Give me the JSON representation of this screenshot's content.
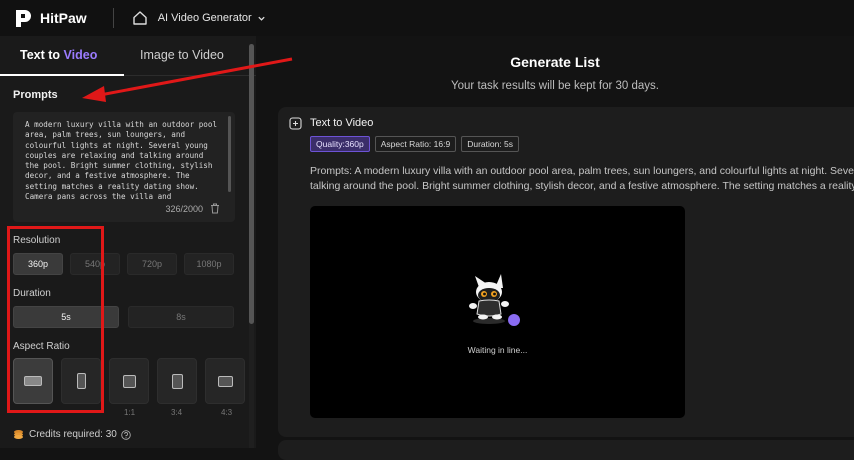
{
  "topbar": {
    "brand": "HitPaw",
    "nav_title": "AI Video Generator",
    "icons": [
      "hitpaw-logo-icon",
      "home-icon",
      "chevron-down-icon"
    ]
  },
  "sidebar": {
    "tabs": [
      {
        "label_prefix": "Text to ",
        "label_accent": "Video",
        "active": true
      },
      {
        "label": "Image to Video",
        "active": false
      }
    ],
    "prompts_label": "Prompts",
    "prompt_text": "A modern luxury villa with an outdoor pool area, palm trees, sun loungers, and colourful lights at night. Several young couples are relaxing and talking around the pool. Bright summer clothing, stylish decor, and a festive atmosphere. The setting matches a reality dating show. Camera pans across the villa and",
    "prompt_counter": "326/2000",
    "resolution_label": "Resolution",
    "resolutions": [
      "360p",
      "540p",
      "720p",
      "1080p"
    ],
    "resolution_selected": "360p",
    "duration_label": "Duration",
    "durations": [
      "5s",
      "8s"
    ],
    "duration_selected": "5s",
    "aspect_label": "Aspect Ratio",
    "aspect_partial_labels": [
      "1:1",
      "3:4",
      "4:3"
    ],
    "credits": "Credits required: 30"
  },
  "main": {
    "title": "Generate List",
    "subtitle": "Your task results will be kept for 30 days.",
    "card": {
      "title": "Text to Video",
      "tags": [
        "Quality:360p",
        "Aspect Ratio: 16:9",
        "Duration: 5s"
      ],
      "prompt_line1": "Prompts:  A modern luxury villa with an outdoor pool area, palm trees, sun loungers, and colourful lights at night. Several young couples are relaxing and",
      "prompt_line2": "talking around the pool. Bright summer clothing, stylish decor, and a festive atmosphere. The setting matches a reality dating show.",
      "status": "Waiting in line..."
    }
  },
  "colors": {
    "accent_purple": "#9b7bff",
    "annotation_red": "#e01818"
  }
}
